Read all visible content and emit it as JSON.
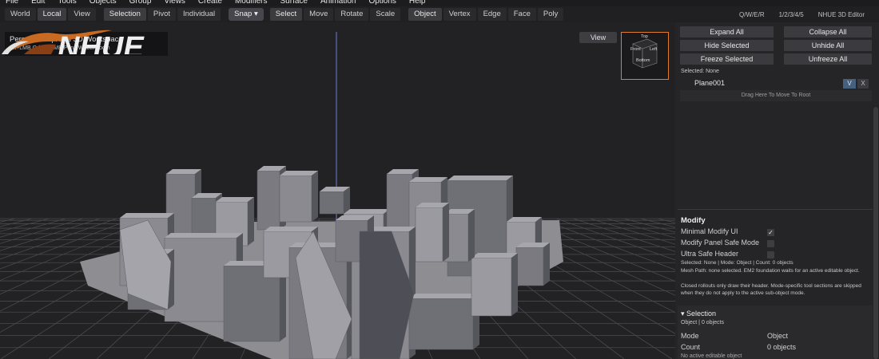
{
  "menu": [
    "File",
    "Edit",
    "Tools",
    "Objects",
    "Group",
    "Views",
    "Create",
    "Modifiers",
    "Surface",
    "Animation",
    "Options",
    "Help"
  ],
  "toolbar": {
    "space_buttons": [
      "World",
      "Local",
      "View"
    ],
    "mode_buttons": [
      "Selection",
      "Pivot",
      "Individual"
    ],
    "snap_label": "Snap ▾",
    "transform_buttons": [
      "Select",
      "Move",
      "Rotate",
      "Scale"
    ],
    "component_buttons": [
      "Object",
      "Vertex",
      "Edge",
      "Face",
      "Poly"
    ],
    "shortcut_hint": "Q/W/E/R",
    "number_hint": "1/2/3/4/5",
    "app_name": "NHUE 3D Editor"
  },
  "viewport": {
    "title": "Perspective | Real 3D Workspace",
    "controls_hint": "Alt+LMB Orbit | MMB Pan | Wheel Zoom",
    "view_button": "View",
    "cube_labels": {
      "top": "Top",
      "front": "Front",
      "left": "Left",
      "bottom": "Bottom"
    },
    "logo_text": "NHUE"
  },
  "outliner": {
    "buttons": [
      "Expand All",
      "Collapse All",
      "Hide Selected",
      "Unhide All",
      "Freeze Selected",
      "Unfreeze All"
    ],
    "selected_label": "Selected: None",
    "object_name": "Plane001",
    "visible_btn": "V",
    "delete_btn": "X",
    "drop_hint": "Drag Here To Move To Root"
  },
  "modify": {
    "title": "Modify",
    "options": [
      {
        "label": "Minimal Modify UI",
        "checked": true
      },
      {
        "label": "Modify Panel Safe Mode",
        "checked": false
      },
      {
        "label": "Ultra Safe Header",
        "checked": false
      }
    ],
    "status": "Selected: None | Mode: Object | Count: 0 objects",
    "mesh_path": "Mesh Path: none selected. EM2 foundation waits for an active editable object.",
    "note": "Closed rollouts only draw their header. Mode-specific tool sections are skipped when they do not apply to the active sub-object mode."
  },
  "selection": {
    "title": "▾ Selection",
    "subtitle": "Object | 0 objects",
    "rows": [
      {
        "key": "Mode",
        "value": "Object"
      },
      {
        "key": "Count",
        "value": "0 objects"
      }
    ],
    "footer": "No active editable object"
  }
}
